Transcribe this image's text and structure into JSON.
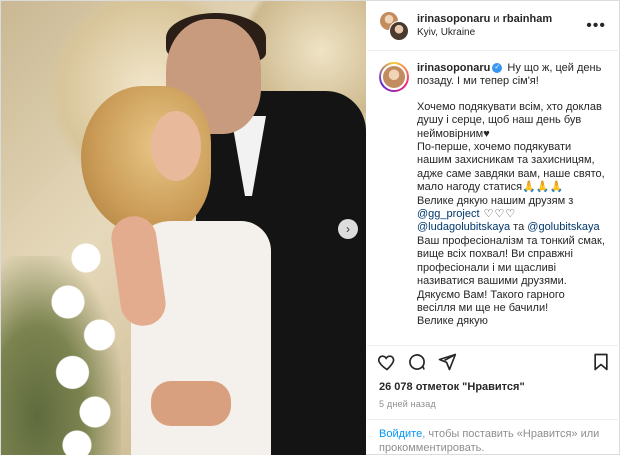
{
  "header": {
    "user1": "irinasoponaru",
    "joiner": " и ",
    "user2": "rbainham",
    "location": "Kyiv, Ukraine",
    "more_icon": "more-horizontal-icon"
  },
  "caption": {
    "username": "irinasoponaru",
    "lines": [
      "Ну що ж, цей день",
      "позаду. І ми тепер сім'я!"
    ],
    "p2_lines": [
      "Хочемо подякувати всім, хто доклав",
      "душу і серце, щоб наш день був",
      "неймовірним♥"
    ],
    "p3_lines": [
      "По-перше, хочемо подякувати",
      "нашим захисникам та захисницям,",
      "адже саме завдяки вам, наше свято,",
      "мало нагоду статися🙏🙏🙏",
      "Велике дякую нашим друзям з"
    ],
    "mention1": "@gg_project",
    "hearts1": " ♡♡♡",
    "mention2": "@ludagolubitskaya",
    "and": " та ",
    "mention3": "@golubitskaya",
    "p4_lines": [
      "Ваш професіоналізм та тонкий смак,",
      "вище всіх похвал! Ви справжні",
      "професіонали і ми щасливі",
      "називатися вашими друзями.",
      "Дякуємо Вам! Такого гарного",
      "весілля ми ще не бачили!",
      "Велике дякую"
    ]
  },
  "likes": "26 078 отметок \"Нравится\"",
  "date": "5 дней назад",
  "login": {
    "link": "Войдите",
    "text": ", чтобы поставить «Нравится» или прокомментировать."
  },
  "icons": {
    "like": "heart-icon",
    "comment": "comment-icon",
    "share": "share-icon",
    "save": "bookmark-icon",
    "next": "chevron-right-icon"
  }
}
